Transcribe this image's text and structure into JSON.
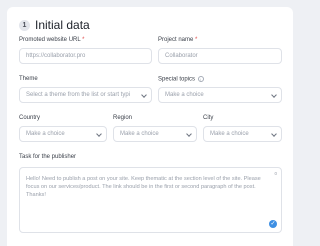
{
  "section": {
    "step": "1",
    "title": "Initial data"
  },
  "fields": {
    "website_url": {
      "label": "Promoted website URL",
      "required_mark": "*",
      "placeholder": "https://collaborator.pro"
    },
    "project_name": {
      "label": "Project name",
      "required_mark": "*",
      "placeholder": "Collaborator"
    },
    "theme": {
      "label": "Theme",
      "placeholder": "Select a theme from the list or start typi"
    },
    "special_topics": {
      "label": "Special topics",
      "info_icon": "i",
      "placeholder": "Make a choice"
    },
    "country": {
      "label": "Country",
      "placeholder": "Make a choice"
    },
    "region": {
      "label": "Region",
      "placeholder": "Make a choice"
    },
    "city": {
      "label": "City",
      "placeholder": "Make a choice"
    },
    "task": {
      "label": "Task for the publisher",
      "counter": "0",
      "placeholder": "Hello! Need to publish a post on your site. Keep thematic at the section level of the site. Please focus on our services/product. The link should be in the first or second paragraph of the post. Thanks!"
    }
  },
  "colors": {
    "accent": "#3d8fe3",
    "required": "#e04848",
    "background": "#eef0f4"
  },
  "icons": {
    "select_chevron": "chevron-down-icon",
    "textarea_handle": "resize-check-icon"
  }
}
